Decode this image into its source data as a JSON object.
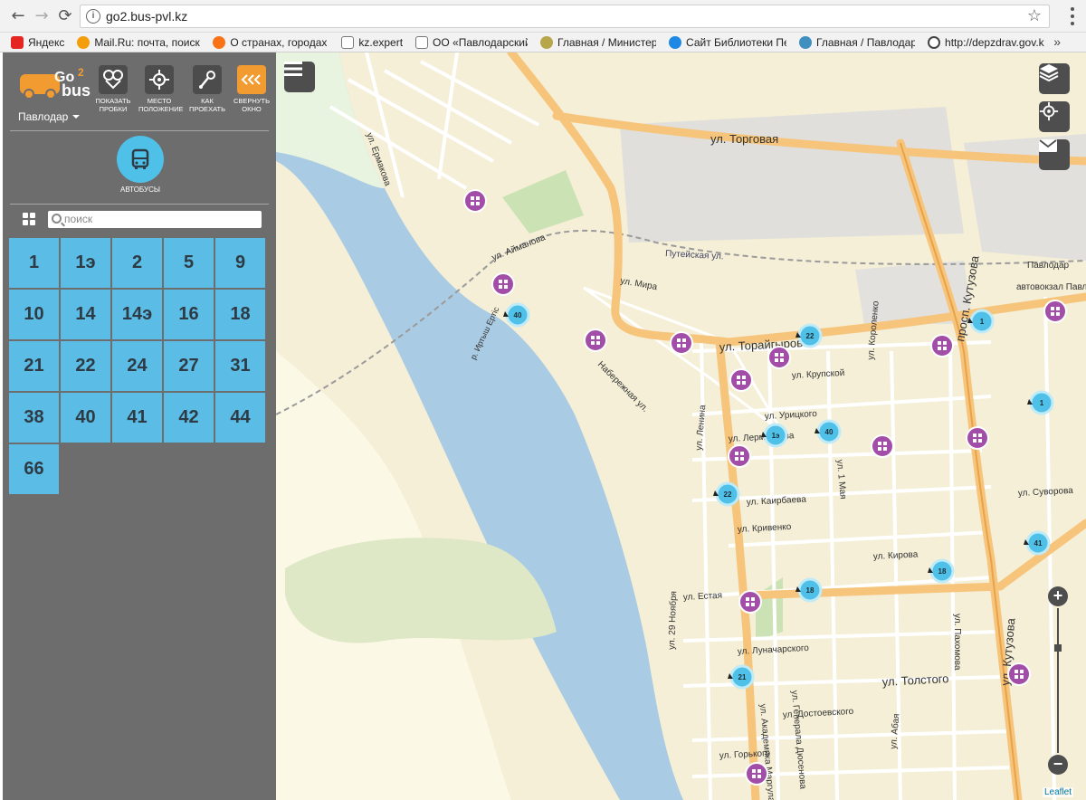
{
  "browser": {
    "url": "go2.bus-pvl.kz",
    "bookmarks": [
      {
        "label": "Яндекс",
        "color": "#e52620"
      },
      {
        "label": "Mail.Ru: почта, поиск",
        "color": "#f59e0b"
      },
      {
        "label": "О странах, городах и",
        "color": "#f97316"
      },
      {
        "label": "kz.expert",
        "color": "#777777"
      },
      {
        "label": "ОО «Павлодарский ,",
        "color": "#777777"
      },
      {
        "label": "Главная / Министерс",
        "color": "#8a7a2a"
      },
      {
        "label": "Сайт Библиотеки Пер",
        "color": "#1e88e5"
      },
      {
        "label": "Главная / Павлодарс",
        "color": "#3f8fbf"
      },
      {
        "label": "http://depzdrav.gov.k",
        "color": "#444444"
      }
    ],
    "more": "»"
  },
  "sidebar": {
    "city": "Павлодар",
    "tools": [
      {
        "label": "ПОКАЗАТЬ ПРОБКИ",
        "icon": "traffic-icon"
      },
      {
        "label": "МЕСТО ПОЛОЖЕНИЕ",
        "icon": "crosshair-icon"
      },
      {
        "label": "КАК ПРОЕХАТЬ",
        "icon": "route-icon"
      },
      {
        "label": "СВЕРНУТЬ ОКНО",
        "icon": "collapse-icon"
      }
    ],
    "transport_label": "АВТОБУСЫ",
    "search_placeholder": "поиск",
    "routes": [
      "1",
      "1э",
      "2",
      "5",
      "9",
      "10",
      "14",
      "14э",
      "16",
      "18",
      "21",
      "22",
      "24",
      "27",
      "31",
      "38",
      "40",
      "41",
      "42",
      "44",
      "66"
    ]
  },
  "map": {
    "streets": [
      "ул. Торговая",
      "ул. Мира",
      "ул. Торайгырова",
      "просп. Кутузова",
      "ул. Кутузова",
      "ул. Айманова",
      "ул. Ермакова",
      "ул. Крупской",
      "ул. Урицкого",
      "ул. Лермонтова",
      "ул. Каирбаева",
      "ул. Кривенко",
      "ул. Кирова",
      "ул. Естая",
      "ул. Толстого",
      "ул. Луначарского",
      "ул. Достоевского",
      "ул. Горького",
      "ул. Суворова",
      "ул. Ленина",
      "ул. 1 Мая",
      "ул. Короленко",
      "ул. Пахомова",
      "ул. Абая",
      "ул. Академика Маргулана",
      "ул. 29 Ноября",
      "ул. Генерала Дюсенова",
      "Набережная ул.",
      "Путейская ул.",
      "р. Иртыш Ертіс",
      "автовокзал Павлодар",
      "Павлодар"
    ],
    "stops_bus": [
      {
        "route": "40"
      },
      {
        "route": "22"
      },
      {
        "route": "1"
      },
      {
        "route": "1"
      },
      {
        "route": "1э"
      },
      {
        "route": "40"
      },
      {
        "route": "22"
      },
      {
        "route": "41"
      },
      {
        "route": "18"
      },
      {
        "route": "18"
      },
      {
        "route": "21"
      }
    ],
    "attribution": "Leaflet"
  },
  "colors": {
    "accent": "#4fc1e9",
    "orange": "#f29b30",
    "sidebar": "#6d6d6d",
    "poi": "#a24ea8"
  }
}
